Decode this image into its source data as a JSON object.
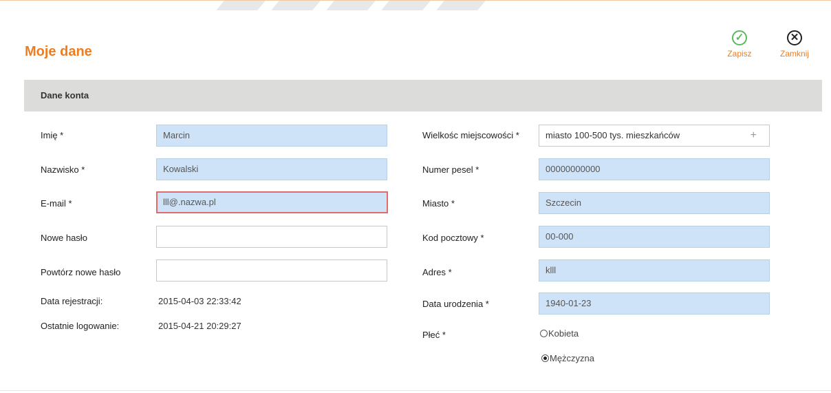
{
  "page": {
    "title": "Moje dane"
  },
  "toolbar": {
    "save_label": "Zapisz",
    "close_label": "Zamknij",
    "save_icon": "check-circle-icon",
    "close_icon": "x-circle-icon"
  },
  "section": {
    "title": "Dane konta"
  },
  "left_fields": {
    "imie": {
      "label": "Imię *",
      "value": "Marcin"
    },
    "nazwisko": {
      "label": "Nazwisko *",
      "value": "Kowalski"
    },
    "email": {
      "label": "E-mail *",
      "value": "lll@.nazwa.pl"
    },
    "nowe_haslo": {
      "label": "Nowe hasło",
      "value": ""
    },
    "powtorz_haslo": {
      "label": "Powtórz nowe hasło",
      "value": ""
    },
    "data_rejestracji": {
      "label": "Data rejestracji:",
      "value": "2015-04-03 22:33:42"
    },
    "ostatnie_logowanie": {
      "label": "Ostatnie logowanie:",
      "value": "2015-04-21 20:29:27"
    }
  },
  "right_fields": {
    "wielkosc": {
      "label": "Wielkośc miejscowości *",
      "value": "miasto 100-500 tys. mieszkańców"
    },
    "pesel": {
      "label": "Numer pesel *",
      "value": "00000000000"
    },
    "miasto": {
      "label": "Miasto *",
      "value": "Szczecin"
    },
    "kod": {
      "label": "Kod pocztowy *",
      "value": "00-000"
    },
    "adres": {
      "label": "Adres *",
      "value": "klll"
    },
    "data_urodzenia": {
      "label": "Data urodzenia *",
      "value": "1940-01-23"
    },
    "plec": {
      "label": "Płeć *",
      "options": [
        "Kobieta",
        "Mężczyzna"
      ],
      "selected": "Mężczyzna"
    }
  },
  "colors": {
    "accent": "#ef7d1f",
    "input_fill": "#cfe3f8",
    "error_border": "#e06b6b",
    "ok_green": "#5cb85c"
  }
}
